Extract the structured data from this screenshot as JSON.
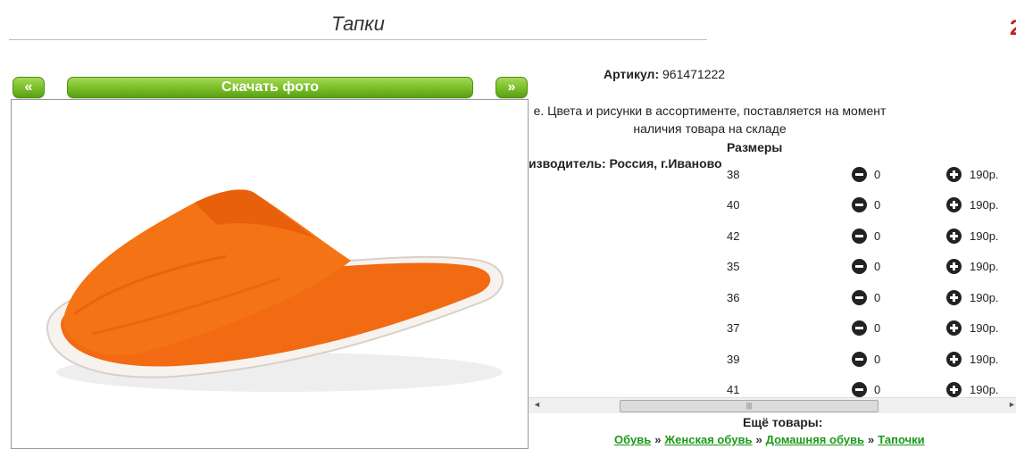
{
  "page": {
    "title": "Тапки"
  },
  "gallery": {
    "prev_label": "«",
    "next_label": "»",
    "download_label": "Скачать фото"
  },
  "product": {
    "article_label": "Артикул:",
    "article_value": "961471222",
    "description": "е. Цвета и рисунки в ассортименте, поставляется на момент наличия товара на складе",
    "manufacturer": "изводитель: Россия, г.Иваново",
    "sizes_header": "Размеры",
    "sizes": [
      {
        "size": "38",
        "qty": "0",
        "price": "190р."
      },
      {
        "size": "40",
        "qty": "0",
        "price": "190р."
      },
      {
        "size": "42",
        "qty": "0",
        "price": "190р."
      },
      {
        "size": "35",
        "qty": "0",
        "price": "190р."
      },
      {
        "size": "36",
        "qty": "0",
        "price": "190р."
      },
      {
        "size": "37",
        "qty": "0",
        "price": "190р."
      },
      {
        "size": "39",
        "qty": "0",
        "price": "190р."
      },
      {
        "size": "41",
        "qty": "0",
        "price": "190р."
      }
    ]
  },
  "footer": {
    "more_label": "Ещё товары:",
    "breadcrumbs": [
      "Обувь",
      "Женская обувь",
      "Домашняя обувь",
      "Тапочки"
    ],
    "separator": "»"
  },
  "colors": {
    "accent_green": "#7cc02b",
    "link_green": "#1a9a1a",
    "slipper_orange": "#f26a12"
  }
}
